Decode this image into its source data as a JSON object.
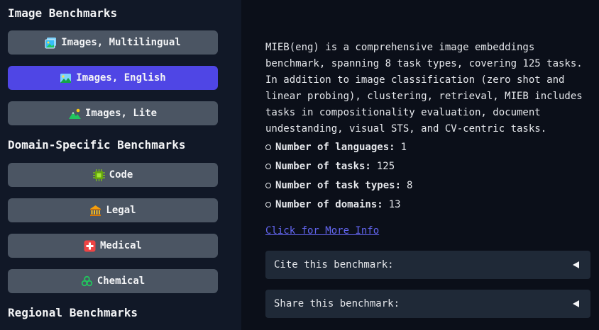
{
  "sidebar": {
    "image_section_title": "Image Benchmarks",
    "image_buttons": [
      {
        "label": "Images, Multilingual",
        "icon": "image-multilingual-icon"
      },
      {
        "label": "Images, English",
        "icon": "landscape-image-icon",
        "active": true
      },
      {
        "label": "Images, Lite",
        "icon": "mountain-sun-icon"
      }
    ],
    "domain_section_title": "Domain-Specific Benchmarks",
    "domain_buttons": [
      {
        "label": "Code",
        "icon": "chip-icon"
      },
      {
        "label": "Legal",
        "icon": "bank-icon"
      },
      {
        "label": "Medical",
        "icon": "medical-cross-icon"
      },
      {
        "label": "Chemical",
        "icon": "biohazard-icon"
      }
    ],
    "regional_section_title": "Regional Benchmarks"
  },
  "main": {
    "description_lines": [
      "MIEB(eng) is a comprehensive image embeddings",
      "benchmark, spanning 8 task types, covering 125 tasks.",
      "In addition to image classification (zero shot and",
      "linear probing), clustering, retrieval, MIEB includes",
      "tasks in compositionality evaluation, document",
      "undestanding, visual STS, and CV-centric tasks."
    ],
    "stats": [
      {
        "label": "Number of languages:",
        "value": "1"
      },
      {
        "label": "Number of tasks:",
        "value": "125"
      },
      {
        "label": "Number of task types:",
        "value": "8"
      },
      {
        "label": "Number of domains:",
        "value": "13"
      }
    ],
    "more_info_link": "Click for More Info",
    "cite_label": "Cite this benchmark:",
    "share_label": "Share this benchmark:"
  },
  "colors": {
    "active_button": "#4f46e5",
    "button": "#4b5563",
    "link": "#6366f1"
  }
}
